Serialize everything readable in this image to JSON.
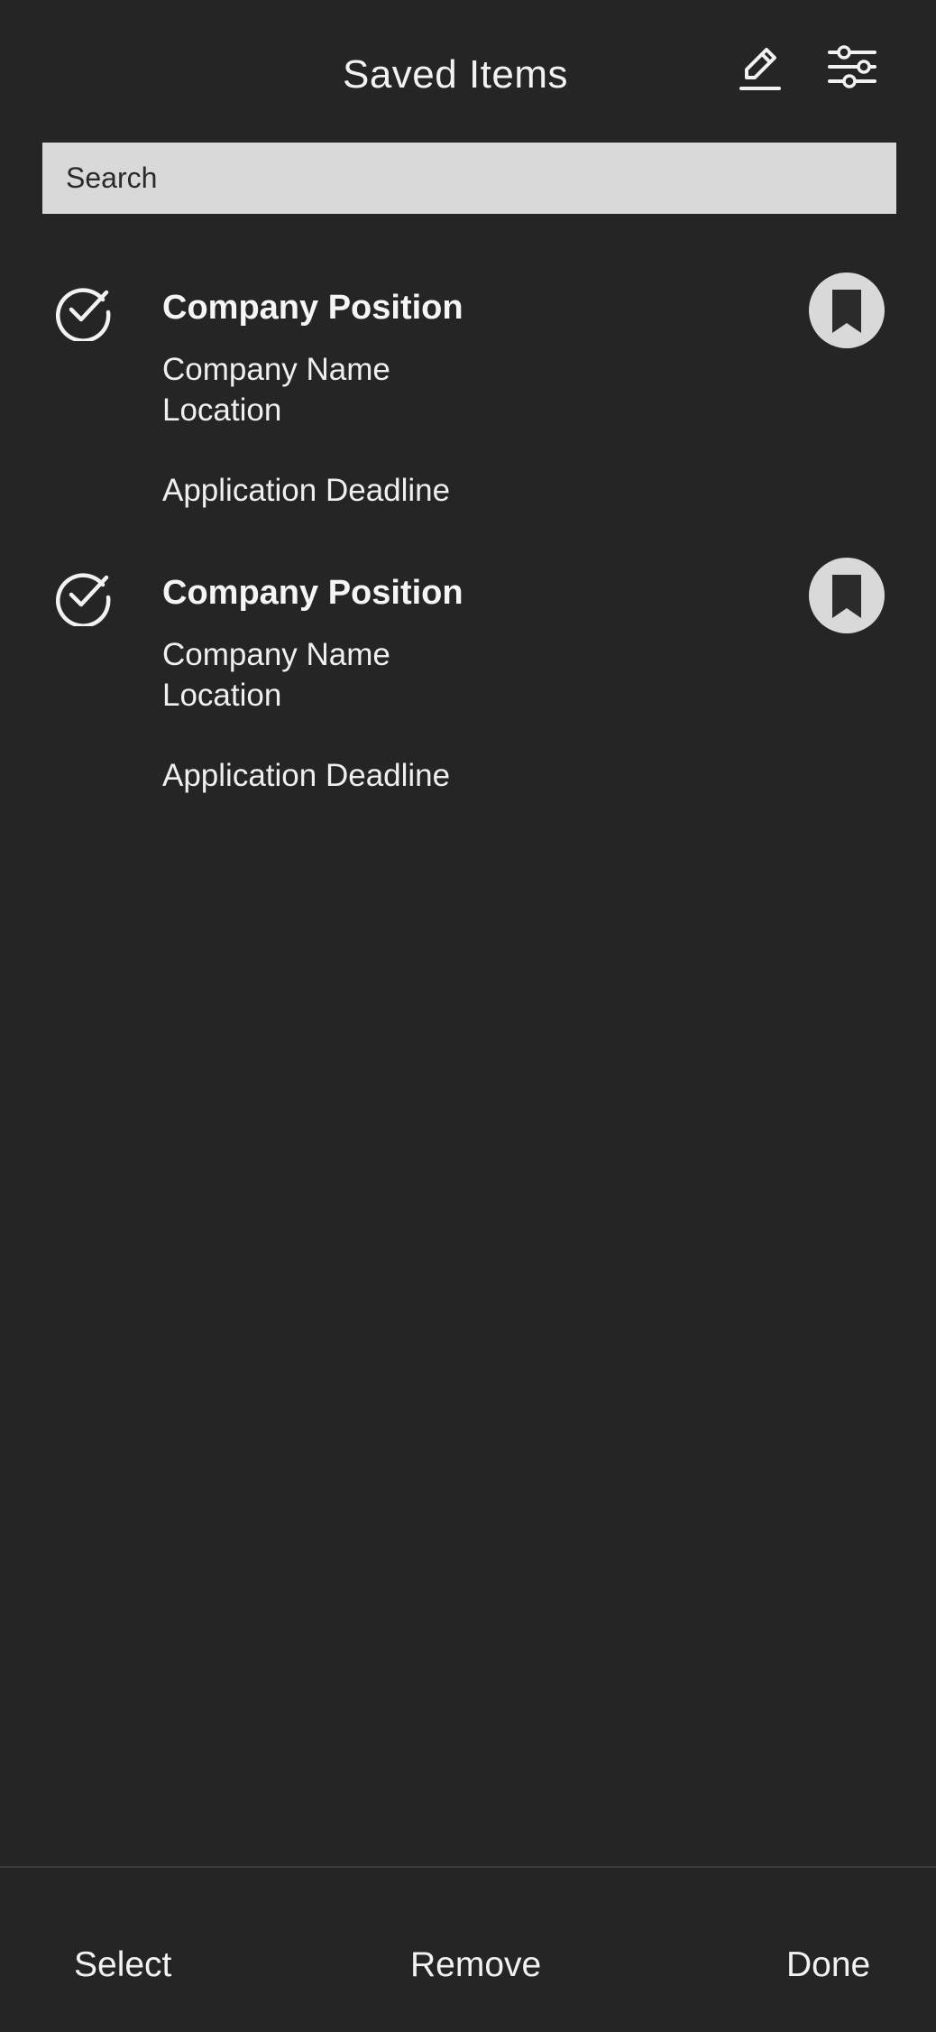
{
  "header": {
    "title": "Saved Items"
  },
  "search": {
    "placeholder": "Search"
  },
  "items": [
    {
      "position": "Company Position",
      "company": "Company Name",
      "location": "Location",
      "deadline": "Application Deadline"
    },
    {
      "position": "Company Position",
      "company": "Company Name",
      "location": "Location",
      "deadline": "Application Deadline"
    }
  ],
  "footer": {
    "select_label": "Select",
    "remove_label": "Remove",
    "done_label": "Done"
  },
  "icons": {
    "edit": "pencil-icon",
    "filter": "sliders-icon",
    "check": "check-circle-icon",
    "bookmark": "bookmark-icon"
  },
  "colors": {
    "background": "#252525",
    "text": "#f2f2f2",
    "search_bg": "#d9d9d9",
    "bookmark_bg": "#d9d9d9",
    "bookmark_icon": "#2b2b2b"
  }
}
